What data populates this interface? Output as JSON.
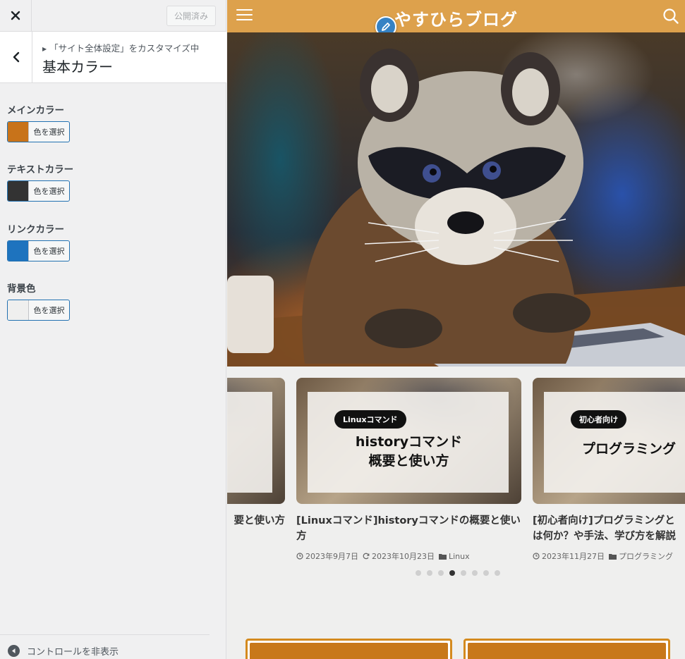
{
  "customizer": {
    "publish_label": "公開済み",
    "breadcrumb": "「サイト全体設定」をカスタマイズ中",
    "section_title": "基本カラー",
    "colors": [
      {
        "label": "メインカラー",
        "button": "色を選択",
        "value": "#c8731a"
      },
      {
        "label": "テキストカラー",
        "button": "色を選択",
        "value": "#333333"
      },
      {
        "label": "リンクカラー",
        "button": "色を選択",
        "value": "#1e73be"
      },
      {
        "label": "背景色",
        "button": "色を選択",
        "value": "#efefee"
      }
    ],
    "collapse_label": "コントロールを非表示"
  },
  "site": {
    "title": "やすひらブログ",
    "header_color": "#dda14c",
    "cards": [
      {
        "title": "[Linuxコマンド]historyコマンドの概要と使い方",
        "partial_title": "要と使い方",
        "image_text": [
          "",
          ""
        ],
        "badge": ""
      },
      {
        "badge": "Linuxコマンド",
        "image_text": [
          "historyコマンド",
          "概要と使い方"
        ],
        "title": "[Linuxコマンド]historyコマンドの概要と使い方",
        "date": "2023年9月7日",
        "updated": "2023年10月23日",
        "category": "Linux"
      },
      {
        "badge": "初心者向け",
        "image_text": [
          "プログラミング",
          ""
        ],
        "title": "[初心者向け]プログラミングとは何か？や手法、学び方を解説",
        "date": "2023年11月27日",
        "category": "プログラミング"
      }
    ],
    "slider_dots": 8,
    "active_dot": 4
  }
}
